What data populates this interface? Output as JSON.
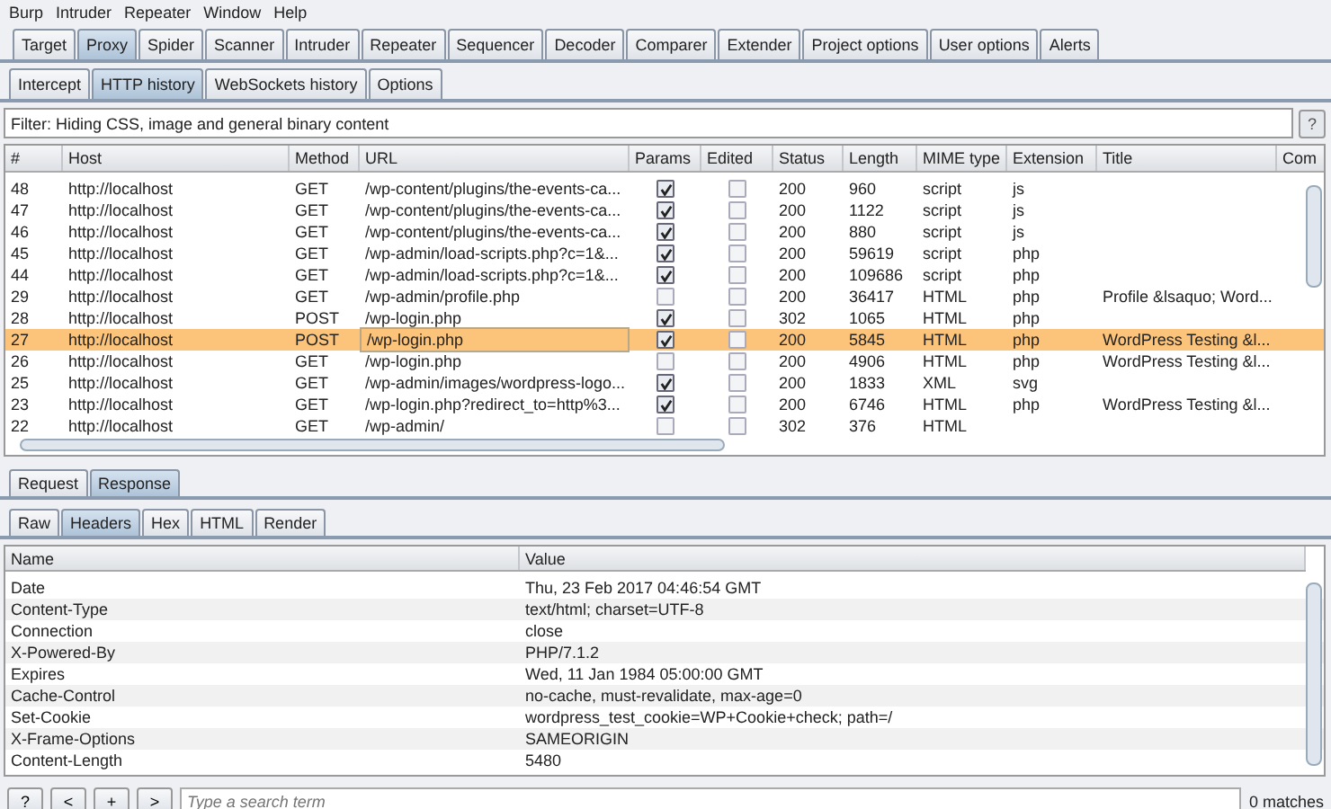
{
  "menu_bar": [
    "Burp",
    "Intruder",
    "Repeater",
    "Window",
    "Help"
  ],
  "main_tabs": [
    {
      "label": "Target",
      "selected": false
    },
    {
      "label": "Proxy",
      "selected": true
    },
    {
      "label": "Spider",
      "selected": false
    },
    {
      "label": "Scanner",
      "selected": false
    },
    {
      "label": "Intruder",
      "selected": false
    },
    {
      "label": "Repeater",
      "selected": false
    },
    {
      "label": "Sequencer",
      "selected": false
    },
    {
      "label": "Decoder",
      "selected": false
    },
    {
      "label": "Comparer",
      "selected": false
    },
    {
      "label": "Extender",
      "selected": false
    },
    {
      "label": "Project options",
      "selected": false
    },
    {
      "label": "User options",
      "selected": false
    },
    {
      "label": "Alerts",
      "selected": false
    }
  ],
  "proxy_tabs": [
    {
      "label": "Intercept",
      "selected": false
    },
    {
      "label": "HTTP history",
      "selected": true
    },
    {
      "label": "WebSockets history",
      "selected": false
    },
    {
      "label": "Options",
      "selected": false
    }
  ],
  "filter": {
    "text": "Filter: Hiding CSS, image and general binary content",
    "help": "?"
  },
  "history_table": {
    "columns": [
      "#",
      "Host",
      "Method",
      "URL",
      "Params",
      "Edited",
      "Status",
      "Length",
      "MIME type",
      "Extension",
      "Title",
      "Com"
    ],
    "rows": [
      {
        "number": "48",
        "host": "http://localhost",
        "method": "GET",
        "url": "/wp-content/plugins/the-events-ca...",
        "params": true,
        "edited": false,
        "status": "200",
        "length": "960",
        "mime": "script",
        "extension": "js",
        "title": "",
        "selected": false
      },
      {
        "number": "47",
        "host": "http://localhost",
        "method": "GET",
        "url": "/wp-content/plugins/the-events-ca...",
        "params": true,
        "edited": false,
        "status": "200",
        "length": "1122",
        "mime": "script",
        "extension": "js",
        "title": "",
        "selected": false
      },
      {
        "number": "46",
        "host": "http://localhost",
        "method": "GET",
        "url": "/wp-content/plugins/the-events-ca...",
        "params": true,
        "edited": false,
        "status": "200",
        "length": "880",
        "mime": "script",
        "extension": "js",
        "title": "",
        "selected": false
      },
      {
        "number": "45",
        "host": "http://localhost",
        "method": "GET",
        "url": "/wp-admin/load-scripts.php?c=1&...",
        "params": true,
        "edited": false,
        "status": "200",
        "length": "59619",
        "mime": "script",
        "extension": "php",
        "title": "",
        "selected": false
      },
      {
        "number": "44",
        "host": "http://localhost",
        "method": "GET",
        "url": "/wp-admin/load-scripts.php?c=1&...",
        "params": true,
        "edited": false,
        "status": "200",
        "length": "109686",
        "mime": "script",
        "extension": "php",
        "title": "",
        "selected": false
      },
      {
        "number": "29",
        "host": "http://localhost",
        "method": "GET",
        "url": "/wp-admin/profile.php",
        "params": false,
        "edited": false,
        "status": "200",
        "length": "36417",
        "mime": "HTML",
        "extension": "php",
        "title": "Profile &lsaquo; Word...",
        "selected": false
      },
      {
        "number": "28",
        "host": "http://localhost",
        "method": "POST",
        "url": "/wp-login.php",
        "params": true,
        "edited": false,
        "status": "302",
        "length": "1065",
        "mime": "HTML",
        "extension": "php",
        "title": "",
        "selected": false
      },
      {
        "number": "27",
        "host": "http://localhost",
        "method": "POST",
        "url": "/wp-login.php",
        "params": true,
        "edited": false,
        "status": "200",
        "length": "5845",
        "mime": "HTML",
        "extension": "php",
        "title": "WordPress Testing &l...",
        "selected": true
      },
      {
        "number": "26",
        "host": "http://localhost",
        "method": "GET",
        "url": "/wp-login.php",
        "params": false,
        "edited": false,
        "status": "200",
        "length": "4906",
        "mime": "HTML",
        "extension": "php",
        "title": "WordPress Testing &l...",
        "selected": false
      },
      {
        "number": "25",
        "host": "http://localhost",
        "method": "GET",
        "url": "/wp-admin/images/wordpress-logo...",
        "params": true,
        "edited": false,
        "status": "200",
        "length": "1833",
        "mime": "XML",
        "extension": "svg",
        "title": "",
        "selected": false
      },
      {
        "number": "23",
        "host": "http://localhost",
        "method": "GET",
        "url": "/wp-login.php?redirect_to=http%3...",
        "params": true,
        "edited": false,
        "status": "200",
        "length": "6746",
        "mime": "HTML",
        "extension": "php",
        "title": "WordPress Testing &l...",
        "selected": false
      },
      {
        "number": "22",
        "host": "http://localhost",
        "method": "GET",
        "url": "/wp-admin/",
        "params": false,
        "edited": false,
        "status": "302",
        "length": "376",
        "mime": "HTML",
        "extension": "",
        "title": "",
        "selected": false
      }
    ]
  },
  "message_tabs": [
    {
      "label": "Request",
      "selected": false
    },
    {
      "label": "Response",
      "selected": true
    }
  ],
  "view_tabs": [
    {
      "label": "Raw",
      "selected": false
    },
    {
      "label": "Headers",
      "selected": true
    },
    {
      "label": "Hex",
      "selected": false
    },
    {
      "label": "HTML",
      "selected": false
    },
    {
      "label": "Render",
      "selected": false
    }
  ],
  "headers_table": {
    "columns": [
      "Name",
      "Value"
    ],
    "rows": [
      {
        "name": "Date",
        "value": "Thu, 23 Feb 2017 04:46:54 GMT"
      },
      {
        "name": "Content-Type",
        "value": "text/html; charset=UTF-8"
      },
      {
        "name": "Connection",
        "value": "close"
      },
      {
        "name": "X-Powered-By",
        "value": "PHP/7.1.2"
      },
      {
        "name": "Expires",
        "value": "Wed, 11 Jan 1984 05:00:00 GMT"
      },
      {
        "name": "Cache-Control",
        "value": "no-cache, must-revalidate, max-age=0"
      },
      {
        "name": "Set-Cookie",
        "value": "wordpress_test_cookie=WP+Cookie+check; path=/"
      },
      {
        "name": "X-Frame-Options",
        "value": "SAMEORIGIN"
      },
      {
        "name": "Content-Length",
        "value": "5480"
      }
    ]
  },
  "search_bar": {
    "buttons": [
      "?",
      "<",
      "+",
      ">"
    ],
    "placeholder": "Type a search term",
    "matches": "0 matches"
  }
}
